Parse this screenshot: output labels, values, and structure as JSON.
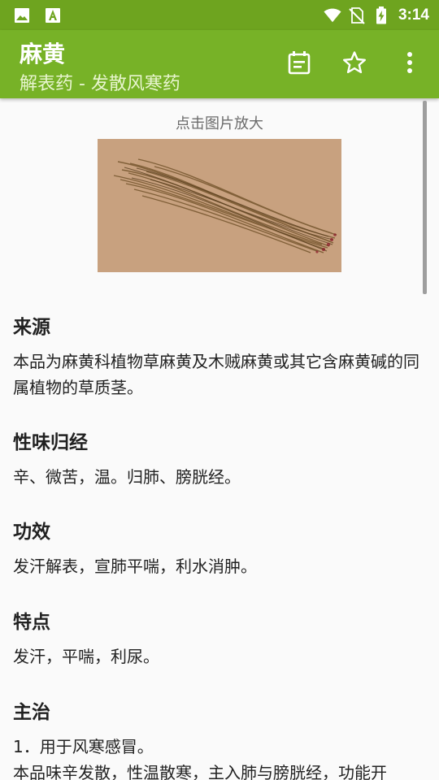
{
  "status_bar": {
    "time": "3:14",
    "icons": [
      "image-icon",
      "text-a-icon",
      "wifi-icon",
      "no-sim-icon",
      "battery-charging-icon"
    ]
  },
  "app_bar": {
    "title": "麻黄",
    "subtitle": "解表药 - 发散风寒药",
    "actions": [
      "calendar-icon",
      "star-outline-icon",
      "overflow-menu-icon"
    ]
  },
  "image": {
    "caption": "点击图片放大"
  },
  "sections": [
    {
      "title": "来源",
      "text": "本品为麻黄科植物草麻黄及木贼麻黄或其它含麻黄碱的同属植物的草质茎。"
    },
    {
      "title": "性味归经",
      "text": "辛、微苦，温。归肺、膀胱经。"
    },
    {
      "title": "功效",
      "text": "发汗解表，宣肺平喘，利水消肿。"
    },
    {
      "title": "特点",
      "text": "发汗，平喘，利尿。"
    },
    {
      "title": "主治",
      "line1": "1．用于风寒感冒。",
      "line2": "本品味辛发散，性温散寒，主入肺与膀胱经，功能开"
    }
  ],
  "colors": {
    "status_bar": "#6ea41f",
    "app_bar": "#77b227",
    "background": "#fafafa"
  }
}
